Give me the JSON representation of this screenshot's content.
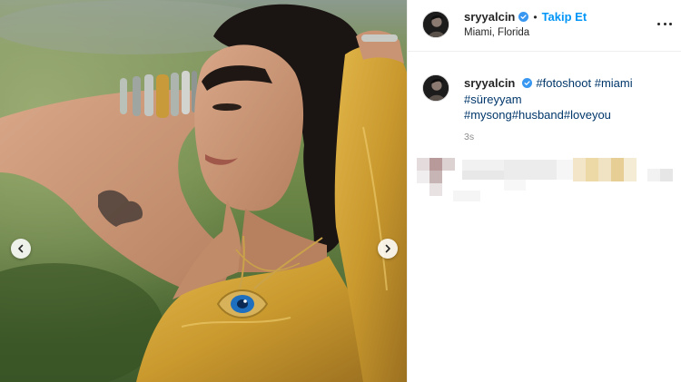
{
  "post": {
    "username": "sryyalcin",
    "verified": true,
    "separator": "•",
    "follow_label": "Takip Et",
    "location": "Miami, Florida",
    "more_icon": "more-horizontal-icon",
    "caption": {
      "username": "sryyalcin",
      "hashtags": [
        "#fotoshoot",
        "#miami",
        "#süreyyam",
        "#mysong",
        "#husband",
        "#loveyou"
      ]
    },
    "time": "3s",
    "nav": {
      "prev_icon": "chevron-left-icon",
      "next_icon": "chevron-right-icon"
    }
  },
  "colors": {
    "link_blue": "#0095f6",
    "hashtag_blue": "#00376b",
    "text": "#262626",
    "muted": "#8e8e8e",
    "verified_badge": "#3897f0",
    "dress_gold": "#c9992e"
  }
}
